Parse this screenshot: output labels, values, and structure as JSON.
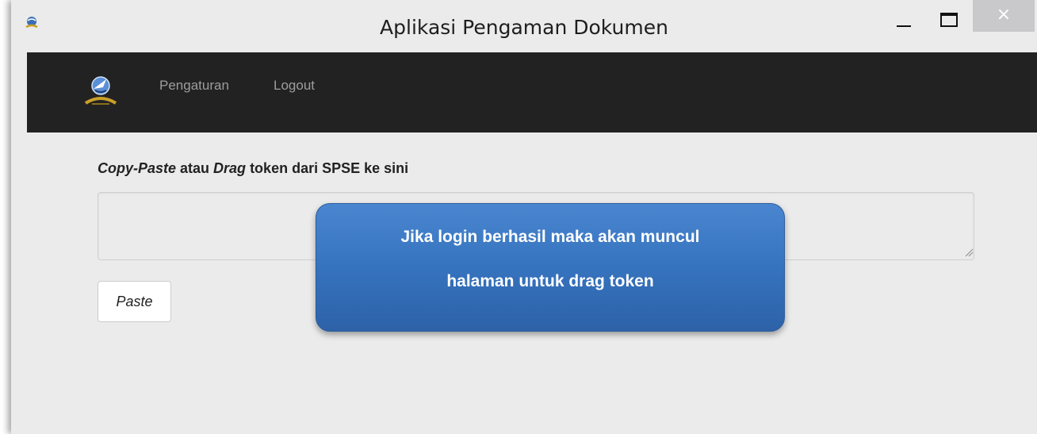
{
  "window": {
    "title": "Aplikasi Pengaman Dokumen",
    "close_label": "×"
  },
  "navbar": {
    "items": [
      {
        "label": "Pengaturan"
      },
      {
        "label": "Logout"
      }
    ]
  },
  "main": {
    "prompt": {
      "part1": "Copy-Paste",
      "part2": " atau ",
      "part3": "Drag",
      "part4": " token dari SPSE ke sini"
    },
    "token_value": "",
    "paste_label": "Paste"
  },
  "callout": {
    "line1": "Jika login berhasil maka akan muncul",
    "line2": "halaman untuk drag token"
  },
  "colors": {
    "navbar_bg": "#222222",
    "window_bg": "#ebebeb",
    "callout_blue": "#3673be"
  }
}
